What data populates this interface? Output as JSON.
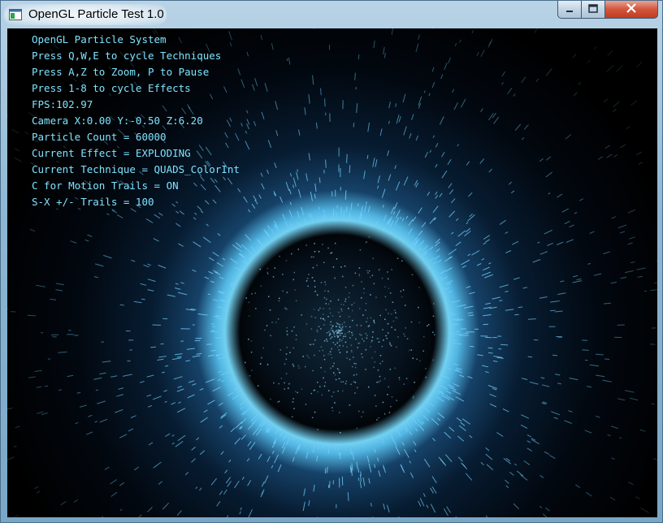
{
  "window": {
    "title": "OpenGL Particle Test 1.0",
    "icon": "app-window-icon",
    "controls": [
      "minimize-icon",
      "maximize-icon",
      "close-icon"
    ]
  },
  "overlay": {
    "lines": [
      "OpenGL Particle System",
      "Press Q,W,E to cycle Techniques",
      "Press A,Z to Zoom, P to Pause",
      "Press 1-8 to cycle Effects",
      "FPS:102.97",
      "Camera X:0.00 Y:-0.50 Z:6.20",
      "Particle Count = 60000",
      "Current Effect = EXPLODING",
      "Current Technique = QUADS_ColorInt",
      "C for Motion Trails = ON",
      "S-X +/- Trails = 100"
    ]
  },
  "scene": {
    "description_color": "#5ac8fa",
    "ring_color": "#b8f0ff",
    "background": "#000000"
  }
}
